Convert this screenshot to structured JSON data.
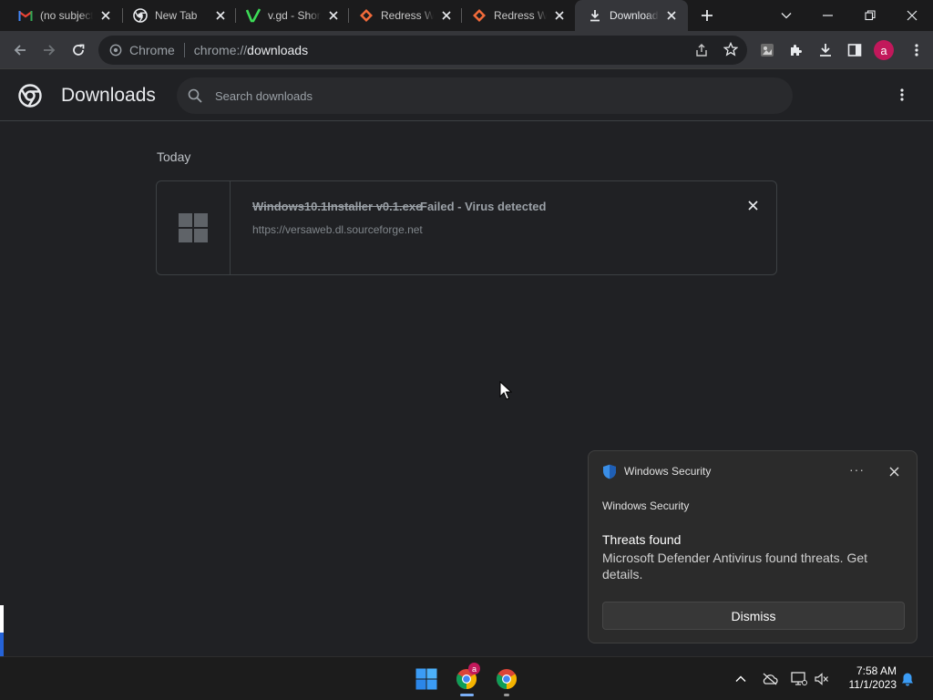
{
  "tabs": [
    {
      "title": "(no subject)",
      "icon": "gmail-icon"
    },
    {
      "title": "New Tab",
      "icon": "chrome-icon"
    },
    {
      "title": "v.gd - Shorten",
      "icon": "vgd-icon"
    },
    {
      "title": "Redress Web",
      "icon": "redress-icon"
    },
    {
      "title": "Redress Web",
      "icon": "redress-icon"
    },
    {
      "title": "Downloads",
      "icon": "download-icon",
      "active": true
    }
  ],
  "toolbar": {
    "scheme_label": "Chrome",
    "url_host": "chrome://",
    "url_path": "downloads",
    "avatar_letter": "a"
  },
  "downloads_page": {
    "title": "Downloads",
    "search_placeholder": "Search downloads",
    "section_label": "Today",
    "items": [
      {
        "file_name": "Windows10.1Installer v0.1.exe",
        "status": "Failed - Virus detected",
        "source": "https://versaweb.dl.sourceforge.net"
      }
    ]
  },
  "toast": {
    "header_title": "Windows Security",
    "app_name": "Windows Security",
    "heading": "Threats found",
    "body": "Microsoft Defender Antivirus found threats. Get details.",
    "dismiss_label": "Dismiss"
  },
  "taskbar": {
    "chrome_badge": "a",
    "time": "7:58 AM",
    "date": "11/1/2023"
  },
  "colors": {
    "accent_blue": "#7aaef5",
    "avatar_pink": "#c2185b",
    "defender_blue": "#3a8ee6"
  }
}
